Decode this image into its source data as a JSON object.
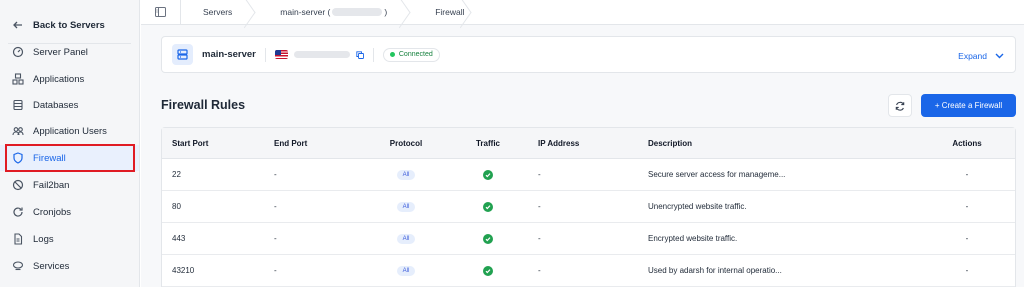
{
  "sidebar": {
    "back_label": "Back to Servers",
    "items": [
      {
        "label": "Server Panel",
        "icon": "gauge-icon"
      },
      {
        "label": "Applications",
        "icon": "apps-icon"
      },
      {
        "label": "Databases",
        "icon": "database-icon"
      },
      {
        "label": "Application Users",
        "icon": "users-icon"
      },
      {
        "label": "Firewall",
        "icon": "shield-icon",
        "active": true
      },
      {
        "label": "Fail2ban",
        "icon": "ban-icon"
      },
      {
        "label": "Cronjobs",
        "icon": "refresh-icon"
      },
      {
        "label": "Logs",
        "icon": "document-icon"
      },
      {
        "label": "Services",
        "icon": "services-icon"
      }
    ]
  },
  "breadcrumb": {
    "items": [
      "Servers",
      "main-server (",
      ")",
      "Firewall"
    ]
  },
  "server": {
    "name": "main-server",
    "status": "Connected",
    "expand_label": "Expand"
  },
  "page": {
    "title": "Firewall Rules",
    "create_button": "+ Create a Firewall"
  },
  "table": {
    "headers": [
      "Start Port",
      "End Port",
      "Protocol",
      "Traffic",
      "IP Address",
      "Description",
      "Actions"
    ],
    "rows": [
      {
        "start": "22",
        "end": "-",
        "protocol": "All",
        "ip": "-",
        "description": "Secure server access for manageme...",
        "actions": "-"
      },
      {
        "start": "80",
        "end": "-",
        "protocol": "All",
        "ip": "-",
        "description": "Unencrypted website traffic.",
        "actions": "-"
      },
      {
        "start": "443",
        "end": "-",
        "protocol": "All",
        "ip": "-",
        "description": "Encrypted website traffic.",
        "actions": "-"
      },
      {
        "start": "43210",
        "end": "-",
        "protocol": "All",
        "ip": "-",
        "description": "Used by adarsh for internal operatio...",
        "actions": "-"
      }
    ]
  },
  "colors": {
    "accent": "#1a66e8",
    "highlight": "#e01b24",
    "success": "#21a150"
  }
}
